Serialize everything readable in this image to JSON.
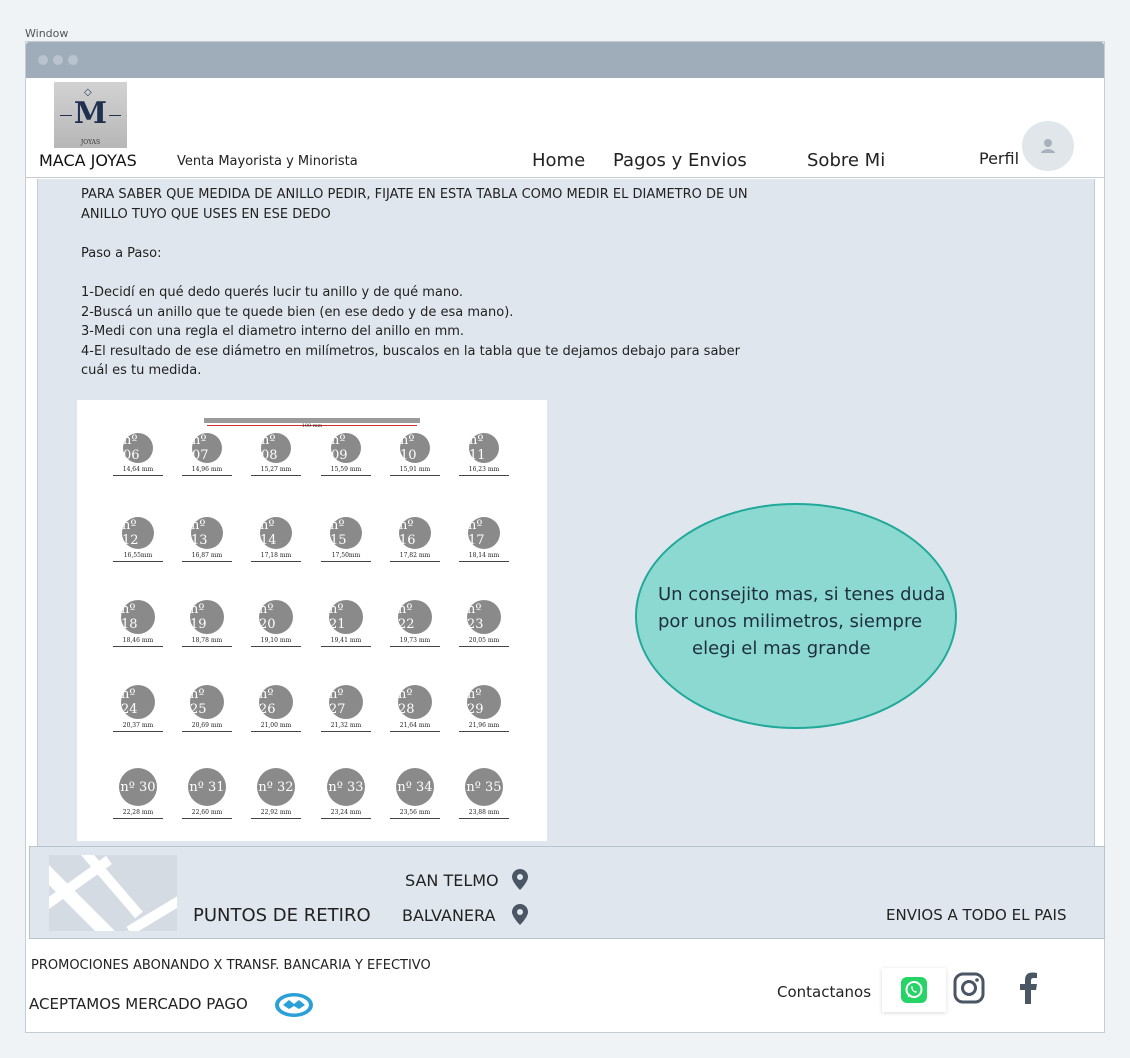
{
  "window": {
    "label": "Window"
  },
  "header": {
    "logo_letter": "M",
    "logo_subtext": "JOYAS",
    "brand": "MACA JOYAS",
    "tagline": "Venta Mayorista y Minorista",
    "nav": [
      "Home",
      "Pagos y Envios",
      "Sobre Mi"
    ],
    "profile_label": "Perfil"
  },
  "content": {
    "intro_line1": "PARA SABER QUE MEDIDA DE ANILLO PEDIR, FIJATE EN ESTA TABLA COMO MEDIR EL DIAMETRO DE UN",
    "intro_line2": "ANILLO TUYO QUE USES EN ESE DEDO",
    "steps_title": "Paso a Paso:",
    "step1": "1-Decidí en qué dedo querés lucir tu anillo y de qué mano.",
    "step2": "2-Buscá un anillo que te quede bien (en ese dedo y de esa mano).",
    "step3": "3-Medi con una regla el diametro interno del anillo en mm.",
    "step4_line1": "4-El resultado de ese diámetro en milímetros, buscalos en la tabla que te dejamos debajo para saber",
    "step4_line2": "cuál es tu medida.",
    "tip_line1": "Un consejito mas, si tenes duda",
    "tip_line2": "por unos milimetros, siempre",
    "tip_line3": "elegi el mas grande"
  },
  "ring_table": {
    "scale_label": "100 mm",
    "rows": [
      [
        {
          "n": "nº 06",
          "mm": "14,64 mm"
        },
        {
          "n": "nº 07",
          "mm": "14,96 mm"
        },
        {
          "n": "nº 08",
          "mm": "15,27 mm"
        },
        {
          "n": "nº 09",
          "mm": "15,59 mm"
        },
        {
          "n": "nº 10",
          "mm": "15,91 mm"
        },
        {
          "n": "nº 11",
          "mm": "16,23 mm"
        }
      ],
      [
        {
          "n": "nº 12",
          "mm": "16,55mm"
        },
        {
          "n": "nº 13",
          "mm": "16,87 mm"
        },
        {
          "n": "nº 14",
          "mm": "17,18 mm"
        },
        {
          "n": "nº 15",
          "mm": "17,50mm"
        },
        {
          "n": "nº 16",
          "mm": "17,82 mm"
        },
        {
          "n": "nº 17",
          "mm": "18,14 mm"
        }
      ],
      [
        {
          "n": "nº 18",
          "mm": "18,46 mm"
        },
        {
          "n": "nº 19",
          "mm": "18,78 mm"
        },
        {
          "n": "nº 20",
          "mm": "19,10 mm"
        },
        {
          "n": "nº 21",
          "mm": "19,41 mm"
        },
        {
          "n": "nº 22",
          "mm": "19,73 mm"
        },
        {
          "n": "nº 23",
          "mm": "20,05 mm"
        }
      ],
      [
        {
          "n": "nº 24",
          "mm": "20,37 mm"
        },
        {
          "n": "nº 25",
          "mm": "20,69 mm"
        },
        {
          "n": "nº 26",
          "mm": "21,00 mm"
        },
        {
          "n": "nº 27",
          "mm": "21,32 mm"
        },
        {
          "n": "nº 28",
          "mm": "21,64 mm"
        },
        {
          "n": "nº 29",
          "mm": "21,96 mm"
        }
      ],
      [
        {
          "n": "nº 30",
          "mm": "22,28 mm"
        },
        {
          "n": "nº 31",
          "mm": "22,60 mm"
        },
        {
          "n": "nº 32",
          "mm": "22,92 mm"
        },
        {
          "n": "nº 33",
          "mm": "23,24 mm"
        },
        {
          "n": "nº 34",
          "mm": "23,56 mm"
        },
        {
          "n": "nº 35",
          "mm": "23,88 mm"
        }
      ]
    ]
  },
  "pickup": {
    "title": "PUNTOS DE RETIRO",
    "locations": [
      "SAN TELMO",
      "BALVANERA"
    ],
    "shipping": "ENVIOS A TODO EL PAIS",
    "icon": "map-pin-icon"
  },
  "footer": {
    "promo": "PROMOCIONES ABONANDO X TRANSF. BANCARIA Y EFECTIVO",
    "mercado_pago": "ACEPTAMOS MERCADO PAGO",
    "contact": "Contactanos",
    "icons": [
      "whatsapp-icon",
      "instagram-icon",
      "facebook-icon"
    ]
  },
  "colors": {
    "titlebar": "#9fadbb",
    "content_bg": "#dfe6ee",
    "bubble_fill": "#8bd9d0",
    "bubble_border": "#21a99a",
    "whatsapp": "#25d366",
    "icon_gray": "#4a5663"
  }
}
